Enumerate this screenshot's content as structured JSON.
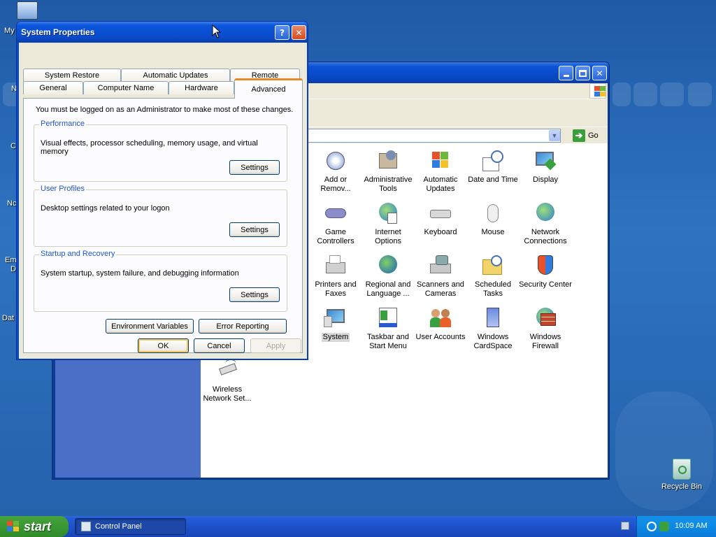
{
  "desktop": {
    "icons_partial": [
      {
        "label": "My"
      },
      {
        "label": "N"
      },
      {
        "label": "C"
      },
      {
        "label": "Nc"
      },
      {
        "label": "Em"
      },
      {
        "label": "D"
      },
      {
        "label": "Dat"
      }
    ],
    "recycle_bin": {
      "label": "Recycle Bin"
    }
  },
  "control_panel": {
    "go_label": "Go",
    "items": [
      {
        "label": "Add or Remov...",
        "icon": "add-remove-programs-icon"
      },
      {
        "label": "Administrative Tools",
        "icon": "administrative-tools-icon"
      },
      {
        "label": "Automatic Updates",
        "icon": "automatic-updates-icon"
      },
      {
        "label": "Date and Time",
        "icon": "date-time-icon"
      },
      {
        "label": "Display",
        "icon": "display-icon"
      },
      {
        "label": "Game Controllers",
        "icon": "game-controllers-icon"
      },
      {
        "label": "Internet Options",
        "icon": "internet-options-icon"
      },
      {
        "label": "Keyboard",
        "icon": "keyboard-icon"
      },
      {
        "label": "Mouse",
        "icon": "mouse-icon"
      },
      {
        "label": "Network Connections",
        "icon": "network-connections-icon"
      },
      {
        "label": "Printers and Faxes",
        "icon": "printers-faxes-icon"
      },
      {
        "label": "Regional and Language ...",
        "icon": "regional-language-icon"
      },
      {
        "label": "Scanners and Cameras",
        "icon": "scanners-cameras-icon"
      },
      {
        "label": "Scheduled Tasks",
        "icon": "scheduled-tasks-icon"
      },
      {
        "label": "Security Center",
        "icon": "security-center-icon"
      },
      {
        "label": "System",
        "icon": "system-icon"
      },
      {
        "label": "Taskbar and Start Menu",
        "icon": "taskbar-start-menu-icon"
      },
      {
        "label": "User Accounts",
        "icon": "user-accounts-icon"
      },
      {
        "label": "Windows CardSpace",
        "icon": "windows-cardspace-icon"
      },
      {
        "label": "Windows Firewall",
        "icon": "windows-firewall-icon"
      },
      {
        "label": "Wireless Network Set...",
        "icon": "wireless-network-setup-icon"
      }
    ]
  },
  "system_properties": {
    "title": "System Properties",
    "help_glyph": "?",
    "close_glyph": "✕",
    "tabs_row1": [
      "System Restore",
      "Automatic Updates",
      "Remote"
    ],
    "tabs_row2": [
      "General",
      "Computer Name",
      "Hardware",
      "Advanced"
    ],
    "active_tab": "Advanced",
    "admin_note": "You must be logged on as an Administrator to make most of these changes.",
    "performance": {
      "title": "Performance",
      "description": "Visual effects, processor scheduling, memory usage, and virtual memory",
      "button": "Settings"
    },
    "user_profiles": {
      "title": "User Profiles",
      "description": "Desktop settings related to your logon",
      "button": "Settings"
    },
    "startup_recovery": {
      "title": "Startup and Recovery",
      "description": "System startup, system failure, and debugging information",
      "button": "Settings"
    },
    "env_vars_button": "Environment Variables",
    "error_reporting_button": "Error Reporting",
    "ok_button": "OK",
    "cancel_button": "Cancel",
    "apply_button": "Apply"
  },
  "taskbar": {
    "start_label": "start",
    "task_control_panel": "Control Panel",
    "clock": "10:09 AM"
  },
  "colors": {
    "xp_blue": "#0a4ccb",
    "start_green": "#3c9a34",
    "tab_accent": "#e68b2c",
    "group_title": "#2155c8"
  }
}
